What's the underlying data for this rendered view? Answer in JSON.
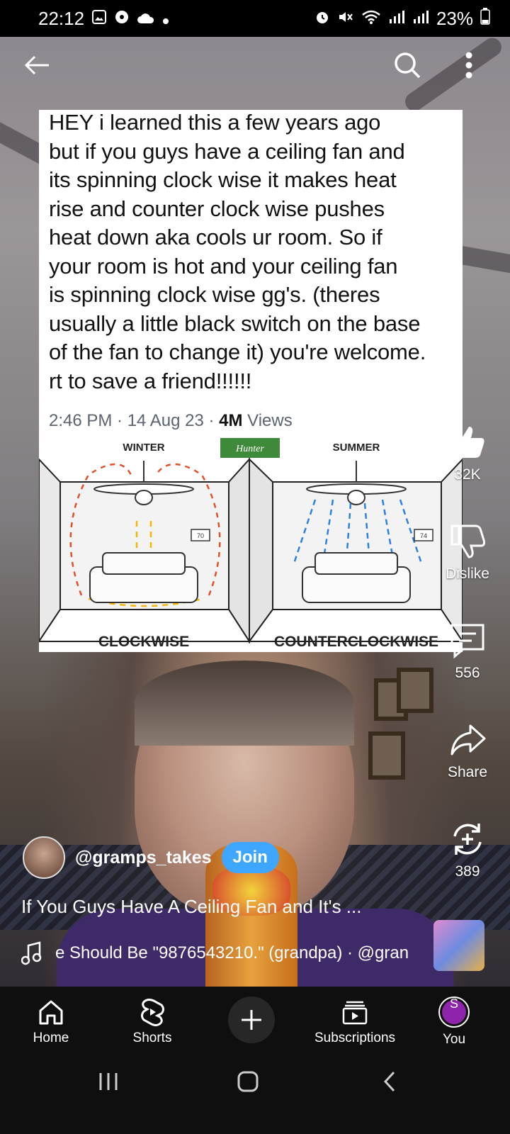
{
  "status_bar": {
    "time": "22:12",
    "battery": "23%"
  },
  "overlay_card": {
    "tweet_lines": [
      "HEY i learned this a few years ago",
      "but if you guys have a ceiling fan and",
      "its spinning clock wise it makes heat",
      "rise and counter clock wise pushes",
      "heat down aka cools ur room. So if",
      "your room is hot and your ceiling fan",
      "is spinning clock wise gg's. (theres",
      "usually a little black switch on the base",
      "of the fan to change it) you're welcome.",
      "rt to save a friend!!!!!!"
    ],
    "meta_prefix": "2:46 PM · 14 Aug 23 · ",
    "views_count": "4M",
    "views_label": " Views",
    "diagram": {
      "left_header": "WINTER",
      "brand": "Hunter",
      "right_header": "SUMMER",
      "left_caption": "CLOCKWISE",
      "right_caption": "COUNTERCLOCKWISE",
      "thermostat_left": "70",
      "thermostat_right": "74"
    }
  },
  "actions": {
    "like_count": "32K",
    "dislike_label": "Dislike",
    "comments_count": "556",
    "share_label": "Share",
    "remix_count": "389"
  },
  "channel": {
    "handle": "@gramps_takes",
    "join_label": "Join"
  },
  "video_title": "If You Guys Have A Ceiling Fan and It's  ...",
  "music_text": "e Should Be \"9876543210.\" (grandpa) · @gran",
  "nav": {
    "home": "Home",
    "shorts": "Shorts",
    "subscriptions": "Subscriptions",
    "you": "You",
    "you_initial": "S"
  },
  "colors": {
    "accent_join": "#3ea6ff",
    "avatar_you": "#8e24aa"
  }
}
